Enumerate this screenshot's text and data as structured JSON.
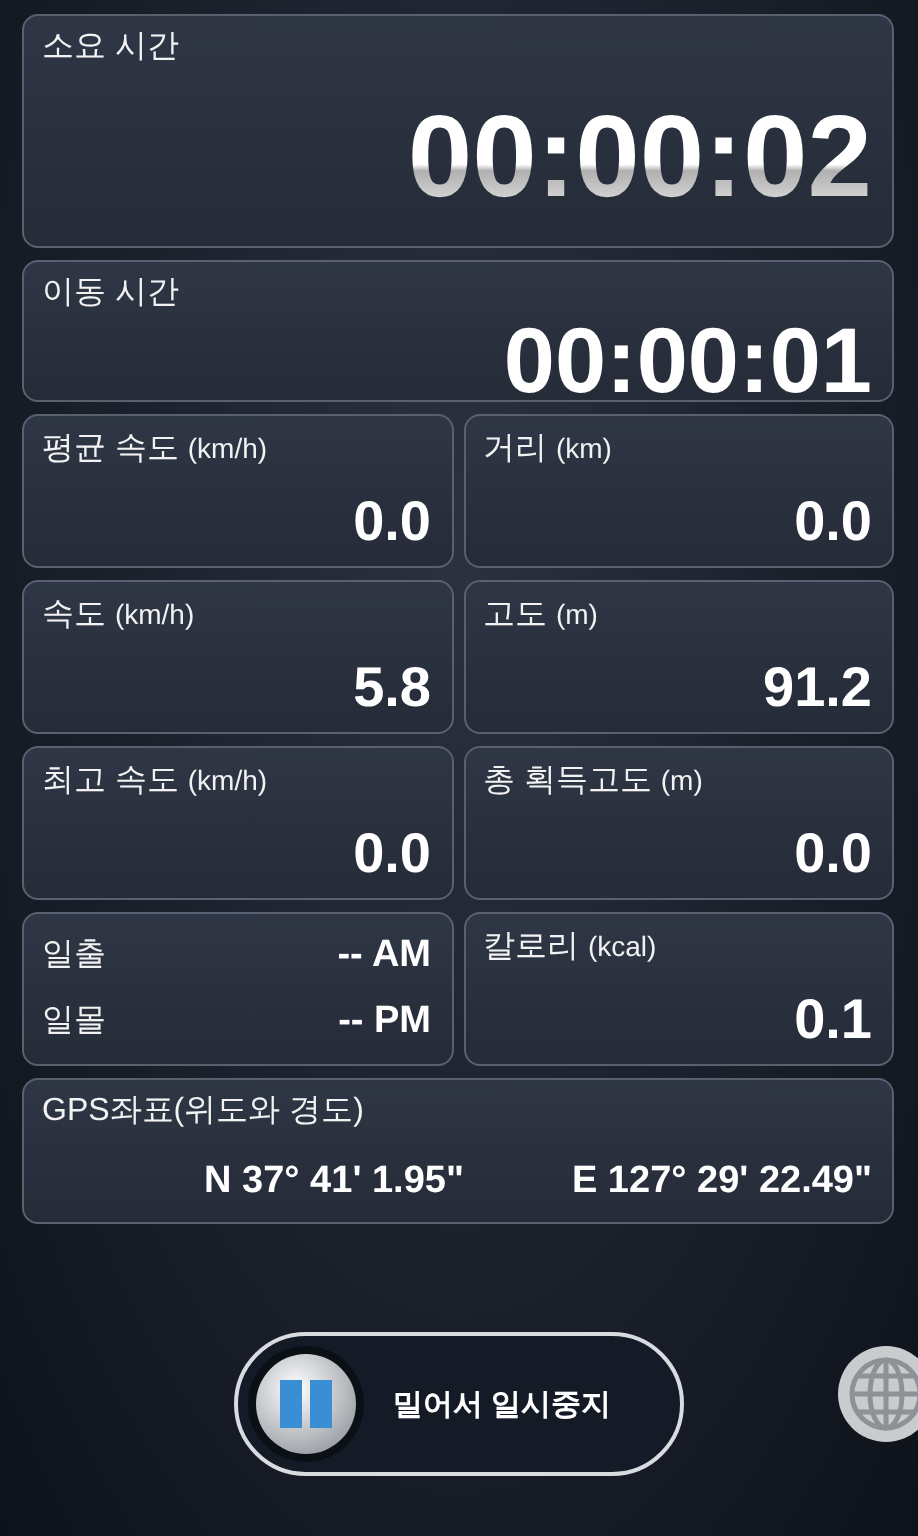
{
  "elapsed": {
    "label": "소요 시간",
    "value": "00:00:02"
  },
  "moving": {
    "label": "이동 시간",
    "value": "00:00:01"
  },
  "cells": [
    {
      "kind": "stat",
      "label": "평균 속도",
      "unit": "(km/h)",
      "value": "0.0"
    },
    {
      "kind": "stat",
      "label": "거리",
      "unit": "(km)",
      "value": "0.0"
    },
    {
      "kind": "stat",
      "label": "속도",
      "unit": "(km/h)",
      "value": "5.8"
    },
    {
      "kind": "stat",
      "label": "고도",
      "unit": "(m)",
      "value": "91.2"
    },
    {
      "kind": "stat",
      "label": "최고 속도",
      "unit": "(km/h)",
      "value": "0.0"
    },
    {
      "kind": "stat",
      "label": "총 획득고도",
      "unit": "(m)",
      "value": "0.0"
    },
    {
      "kind": "sun",
      "rows": [
        {
          "label": "일출",
          "value": "-- AM"
        },
        {
          "label": "일몰",
          "value": "-- PM"
        }
      ]
    },
    {
      "kind": "stat",
      "label": "칼로리",
      "unit": "(kcal)",
      "value": "0.1"
    }
  ],
  "gps": {
    "label": "GPS좌표(위도와 경도)",
    "latitude": "N 37° 41' 1.95\"",
    "longitude": "E 127° 29' 22.49\""
  },
  "slider": {
    "label": "밀어서 일시중지",
    "level": 0
  }
}
